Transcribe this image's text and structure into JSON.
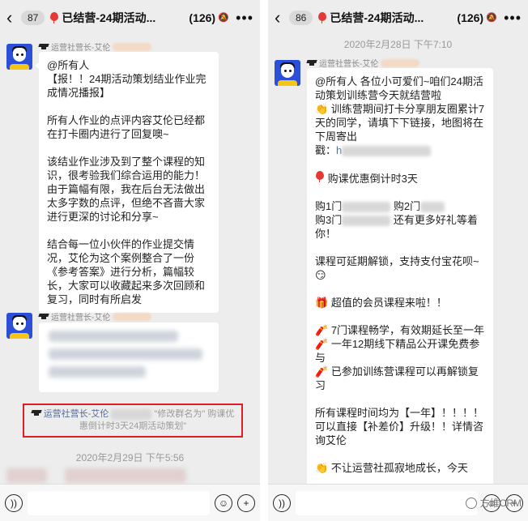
{
  "left": {
    "header": {
      "unread": "87",
      "title": "已结营-24期活动...",
      "member_count": "(126)"
    },
    "sender_name": "运营社营长-艾伦",
    "message1": {
      "lines": [
        "@所有人",
        "【报！！24期活动策划结业作业完成情况播报】",
        "所有人作业的点评内容艾伦已经都在打卡圈内进行了回复噢~",
        "该结业作业涉及到了整个课程的知识，很考验我们综合运用的能力！由于篇幅有限，我在后台无法做出太多字数的点评，但绝不吝啬大家进行更深的讨论和分享~",
        "结合每一位小伙伴的作业提交情况，艾伦为这个案例整合了一份《参考答案》进行分析，篇幅较长，大家可以收藏起来多次回顾和复习，同时有所启发"
      ]
    },
    "system_notice": {
      "name": "运营社营长-艾伦",
      "action": "\"修改群名为\"",
      "rest": "购课优惠倒计时3天24期活动策划\""
    },
    "timestamp": "2020年2月29日 下午5:56"
  },
  "right": {
    "header": {
      "unread": "86",
      "title": "已结营-24期活动...",
      "member_count": "(126)"
    },
    "timestamp": "2020年2月28日 下午7:10",
    "sender_name": "运营社营长-艾伦",
    "message": {
      "p1": "@所有人 各位小可爱们~咱们24期活动策划训练营今天就结营啦",
      "p1b": "训练营期间打卡分享朋友圈累计7天的同学，请填下下链接，地图将在下周寄出",
      "p1c_label": "戳：",
      "p1c_link": "h",
      "p2": "购课优惠倒计时3天",
      "p3a": "购1门",
      "p3b": "购2门",
      "p3c": "购3门",
      "p3d": "还有更多好礼等着你！",
      "p4": "课程可延期解锁，支持支付宝花呗~",
      "p5": "超值的会员课程来啦！！",
      "p6a": "7门课程畅学，有效期延长至一年",
      "p6b": "一年12期线下精品公开课免费参与",
      "p6c": "已参加训练营课程可以再解锁复习",
      "p7": "所有课程时间均为【一年】！！！！ 可以直接【补差价】升级！！详情咨询艾伦",
      "p8": "不让运营社孤寂地成长，今天"
    },
    "watermark": "方维CRM"
  }
}
